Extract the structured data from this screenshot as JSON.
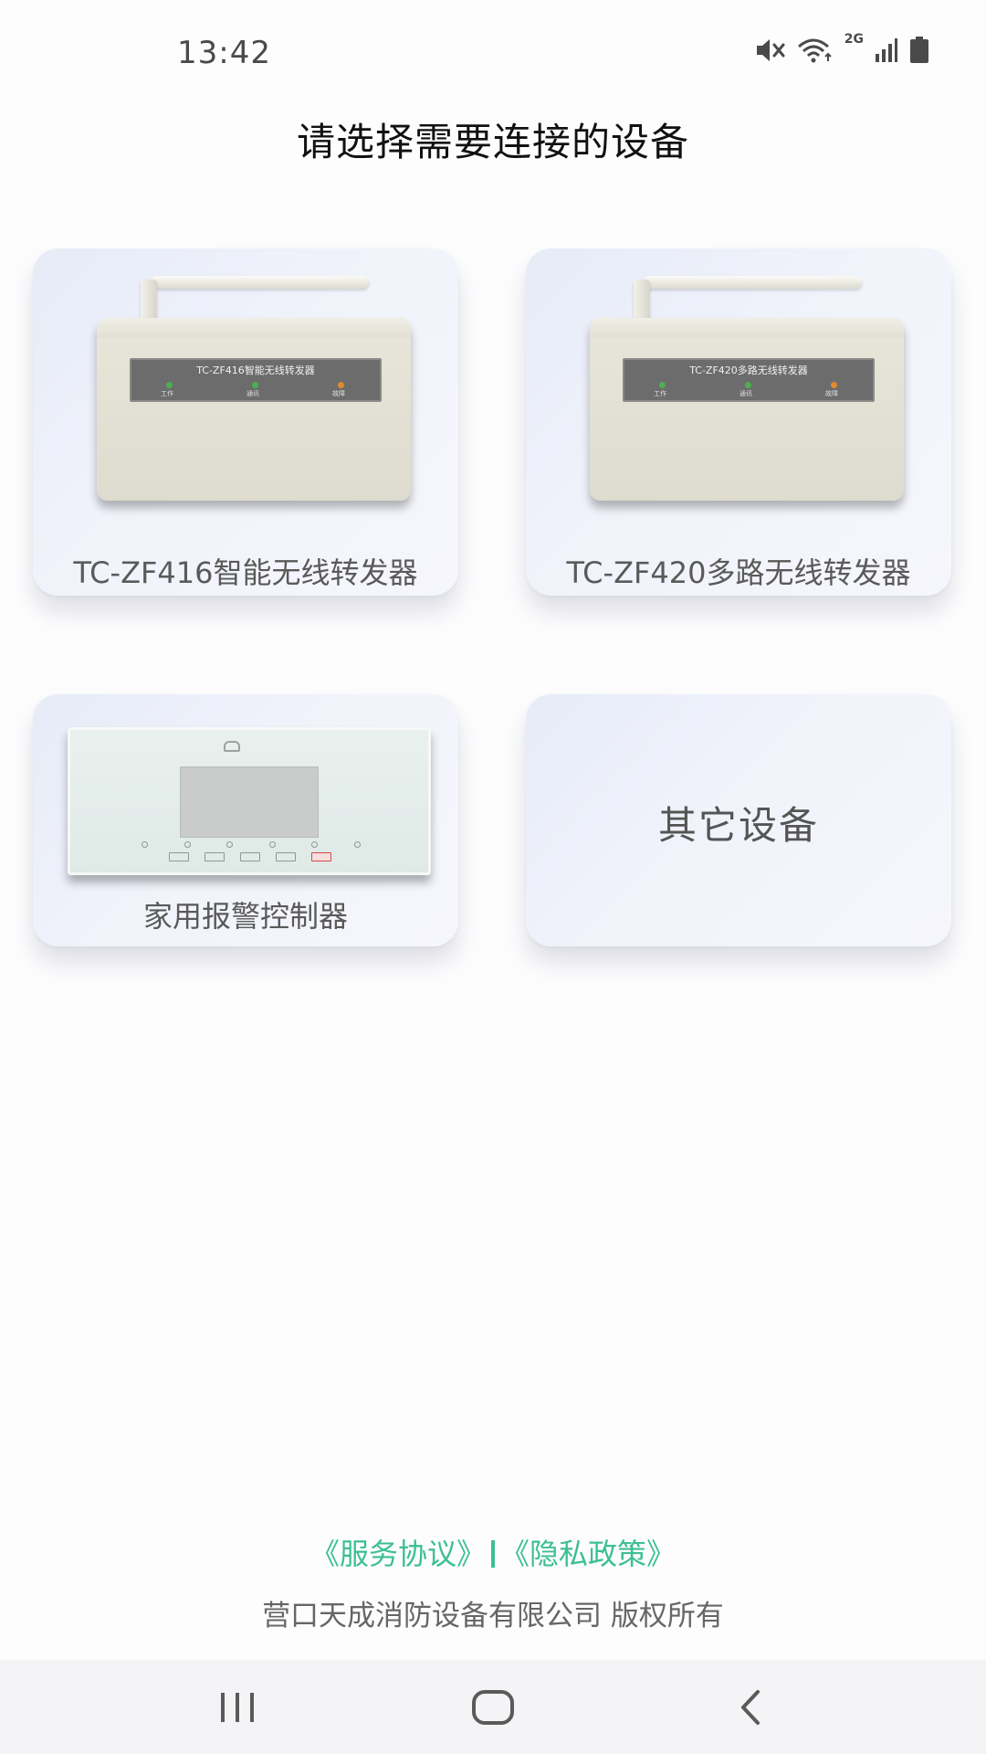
{
  "status_bar": {
    "time": "13:42",
    "network_label": "2G",
    "icons": [
      "mute-icon",
      "wifi-icon",
      "signal-icon",
      "battery-icon"
    ]
  },
  "page": {
    "title": "请选择需要连接的设备"
  },
  "devices": [
    {
      "label": "TC-ZF416智能无线转发器",
      "panel_title": "TC-ZF416智能无线转发器",
      "leds": [
        "工作",
        "通讯",
        "故障"
      ]
    },
    {
      "label": "TC-ZF420多路无线转发器",
      "panel_title": "TC-ZF420多路无线转发器",
      "leds": [
        "工作",
        "通讯",
        "故障"
      ]
    },
    {
      "label": "家用报警控制器"
    },
    {
      "label": "其它设备"
    }
  ],
  "footer": {
    "service_agreement": "《服务协议》",
    "privacy_policy": "《隐私政策》",
    "copyright": "营口天成消防设备有限公司 版权所有"
  },
  "colors": {
    "accent": "#3dbf93",
    "led_green": "#4caf50",
    "led_orange": "#e08a2e"
  },
  "nav_bar": {
    "icons": [
      "recent-apps-icon",
      "home-icon",
      "back-icon"
    ]
  }
}
